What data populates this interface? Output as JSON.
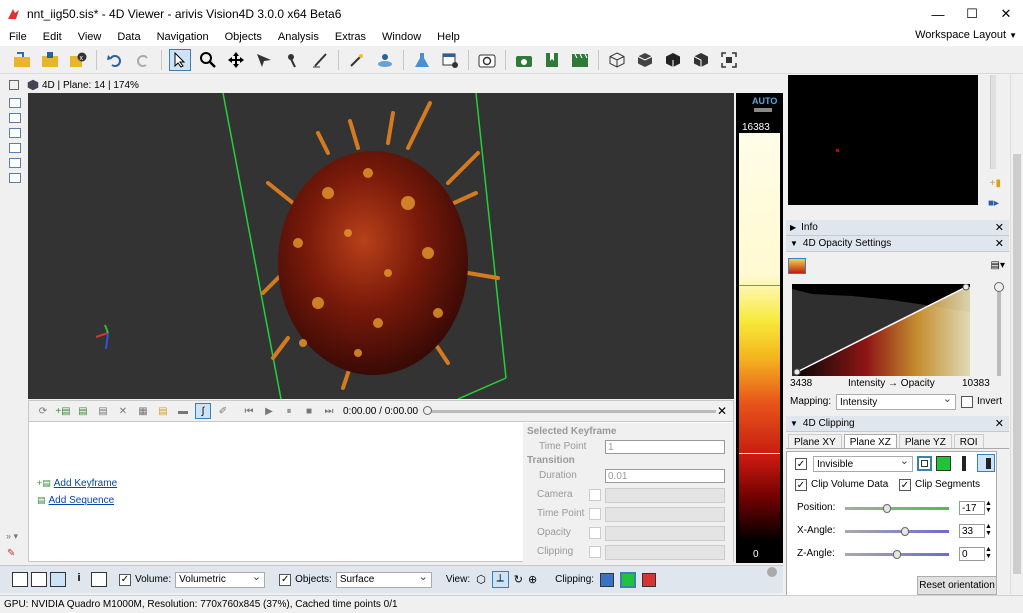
{
  "window": {
    "title": "nnt_iig50.sis* - 4D Viewer - arivis Vision4D 3.0.0 x64 Beta6",
    "min": "—",
    "max": "☐",
    "close": "✕"
  },
  "menu": {
    "items": [
      "File",
      "Edit",
      "View",
      "Data",
      "Navigation",
      "Objects",
      "Analysis",
      "Extras",
      "Window",
      "Help"
    ],
    "workspace": "Workspace Layout"
  },
  "viewer": {
    "header": "4D  |  Plane: 14  |  174%"
  },
  "colorbar": {
    "auto": "AUTO",
    "max": "16383",
    "min": "0"
  },
  "animation": {
    "time": "0:00.00 / 0:00.00",
    "add_keyframe": "Add Keyframe",
    "add_sequence": "Add Sequence",
    "selected_keyframe": "Selected Keyframe",
    "time_point_label": "Time Point",
    "time_point_value": "1",
    "transition": "Transition",
    "duration_label": "Duration",
    "duration_value": "0.01",
    "camera": "Camera",
    "time_point2": "Time Point",
    "opacity": "Opacity",
    "clipping": "Clipping"
  },
  "bottombar": {
    "volume_label": "Volume:",
    "volume_value": "Volumetric",
    "objects_label": "Objects:",
    "objects_value": "Surface",
    "view_label": "View:",
    "clipping_label": "Clipping:",
    "clip_colors": [
      "#3a73c6",
      "#22c33a",
      "#d73434"
    ]
  },
  "status": {
    "text": "GPU: NVIDIA Quadro M1000M, Resolution: 770x760x845 (37%), Cached time points 0/1"
  },
  "panels": {
    "info": "Info",
    "opacity": "4D Opacity Settings",
    "opacity_min": "3438",
    "opacity_axis": "Intensity → Opacity",
    "opacity_max": "10383",
    "mapping_label": "Mapping:",
    "mapping_value": "Intensity",
    "invert_label": "Invert",
    "clipping": "4D Clipping",
    "tabs": [
      "Plane XY",
      "Plane XZ",
      "Plane YZ",
      "ROI"
    ],
    "mode_value": "Invisible",
    "clip_volume": "Clip Volume Data",
    "clip_segments": "Clip Segments",
    "position_label": "Position:",
    "position_value": "-17",
    "xangle_label": "X-Angle:",
    "xangle_value": "33",
    "zangle_label": "Z-Angle:",
    "zangle_value": "0",
    "reset": "Reset orientation"
  }
}
